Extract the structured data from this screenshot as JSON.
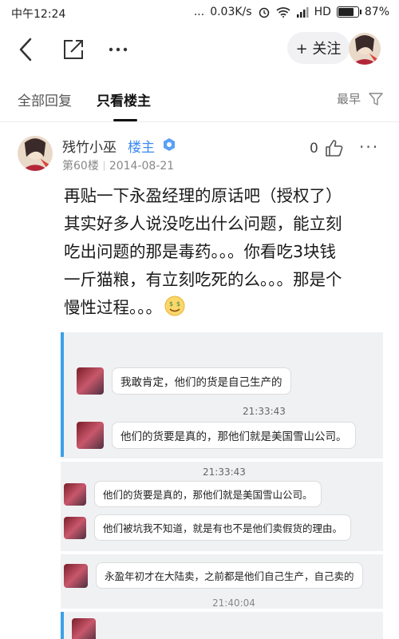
{
  "status": {
    "time": "中午12:24",
    "dots": "...",
    "speed": "0.03K/s",
    "network": "HD",
    "battery": "87%",
    "battery_level": 0.87
  },
  "nav": {
    "back_icon": "back-arrow-icon",
    "share_icon": "share-icon",
    "more_icon": "more-dots-icon",
    "follow_label": "+ 关注"
  },
  "tabs": {
    "all_replies": "全部回复",
    "host_only": "只看楼主",
    "sort_label": "最早",
    "filter_icon": "filter-icon"
  },
  "post": {
    "username": "残竹小巫",
    "host_tag": "楼主",
    "floor": "第60楼",
    "date": "2014-08-21",
    "like_count": "0",
    "more": "···",
    "body_lines": [
      "再贴一下永盈经理的原话吧（授权了）",
      "其实好多人说没吃出什么问题，能立刻",
      "吃出问题的那是毒药。。。你看吃3块钱",
      "一斤猫粮，有立刻吃死的么。。。那是个",
      "慢性过程。。。"
    ]
  },
  "screenshot": {
    "messages": [
      "我敢肯定，他们的货是自己生产的",
      "他们的货要是真的，那他们就是美国雪山公司。",
      "他们的货要是真的，那他们就是美国雪山公司。",
      "他们被坑我不知道，就是有也不是他们卖假货的理由。",
      "永盈年初才在大陆卖，之前都是他们自己生产，自己卖的"
    ],
    "timestamps": [
      "21:33:43",
      "21:33:43",
      "21:40:04"
    ]
  },
  "colors": {
    "accent_blue": "#3e8af2",
    "quote_bar": "#3ba0e8"
  }
}
